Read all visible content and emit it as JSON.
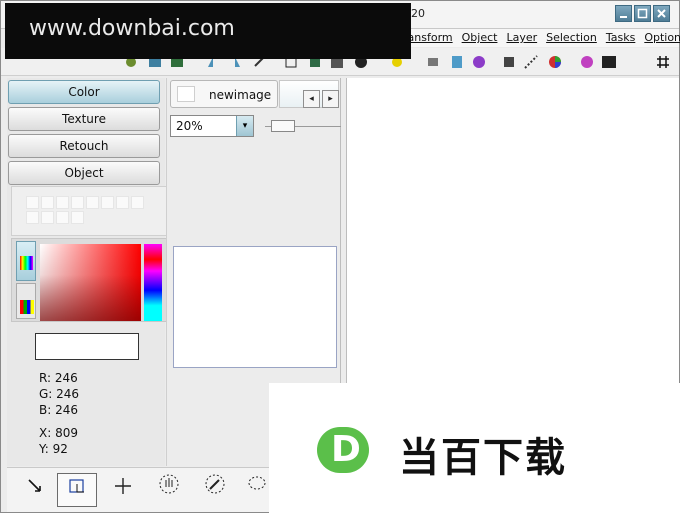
{
  "window": {
    "title_fragment": "20"
  },
  "watermarks": {
    "top_text": "www.downbai.com",
    "bottom_text": "当百下载",
    "bottom_logo_letter": "D"
  },
  "menubar": {
    "items": [
      "ransform",
      "Object",
      "Layer",
      "Selection",
      "Tasks",
      "Options"
    ]
  },
  "leftpanel": {
    "tabs": [
      "Color",
      "Texture",
      "Retouch",
      "Object"
    ],
    "active_tab": "Color",
    "readout": {
      "r": "R: 246",
      "g": "G: 246",
      "b": "B: 246",
      "x": "X: 809",
      "y": "Y: 92"
    }
  },
  "midpanel": {
    "doc_tab_label": "newimage",
    "zoom_value": "20%",
    "prev_arrow": "◂",
    "next_arrow": "▸",
    "dropdown_arrow": "▾"
  },
  "colors": {
    "accent": "#a9cfdc",
    "logo_green": "#5bbf4a"
  },
  "tools": {
    "icons": [
      "pointer-tool-icon",
      "crop-tool-icon",
      "move-tool-icon",
      "hand-tool-icon",
      "eyedropper-tool-icon",
      "lasso-tool-icon"
    ]
  }
}
